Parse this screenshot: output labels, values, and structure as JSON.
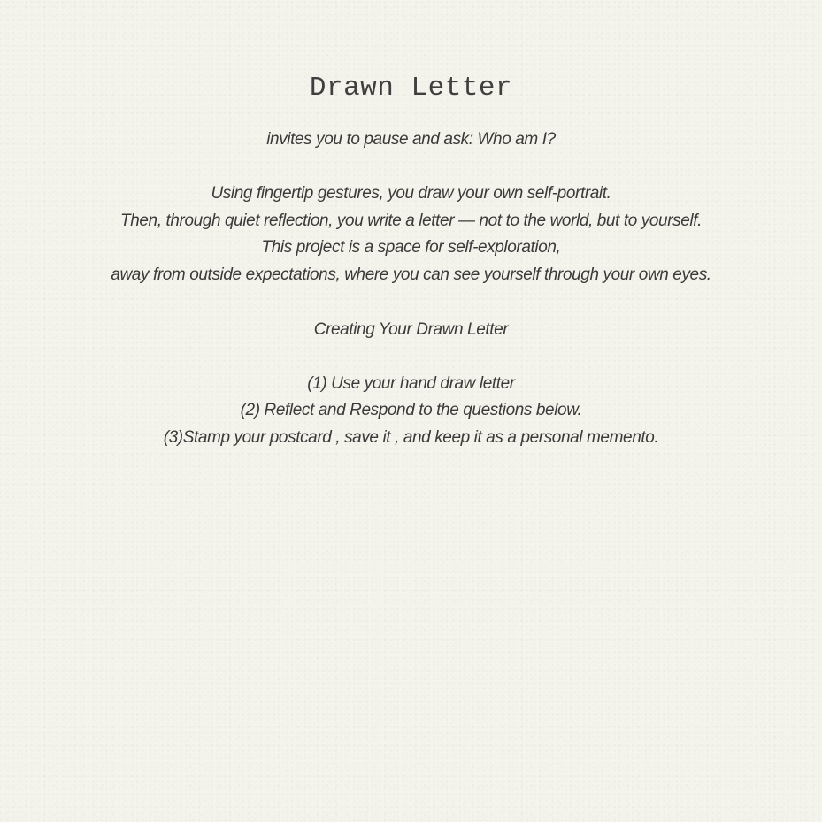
{
  "title": "Drawn Letter",
  "subtitle": "invites you to pause and ask: Who am I?",
  "intro": [
    "Using fingertip gestures, you draw your own self-portrait.",
    "Then, through quiet reflection, you write a letter — not to the world, but to yourself.",
    "This project is a space for self-exploration,",
    "away from outside expectations, where you can see yourself through your own eyes."
  ],
  "section_title": "Creating Your Drawn Letter",
  "steps": [
    "(1) Use your hand draw letter",
    "(2) Reflect and Respond to the questions below.",
    "(3)Stamp your postcard , save it , and keep it as a personal memento."
  ],
  "colors": {
    "background": "#f5f4ec",
    "text": "#3a3a3a"
  }
}
